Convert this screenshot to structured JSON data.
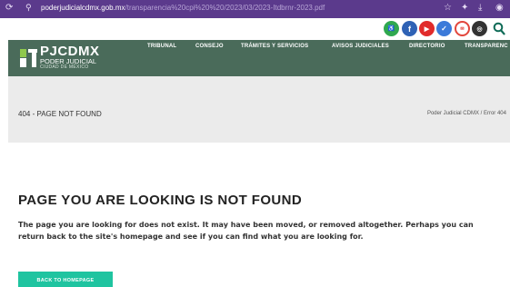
{
  "browser": {
    "url_host": "poderjudicialcdmx.gob.mx",
    "url_path": "/transparencia%20cpi%20%20/2023/03/2023-Itdbrnr-2023.pdf",
    "reload_icon": "reload-icon",
    "site_info_icon": "site-info-icon",
    "star_icon": "star-icon",
    "extensions_icon": "extensions-icon",
    "download_icon": "download-icon",
    "profile_icon": "profile-icon"
  },
  "social": {
    "icons": [
      "accessibility-icon",
      "facebook-icon",
      "youtube-icon",
      "twitter-icon",
      "vivo-icon",
      "instagram-icon"
    ],
    "search_icon": "search-icon"
  },
  "colors": {
    "browser_bar": "#5b3a8c",
    "header_green": "#4a6b5a",
    "band_gray": "#ebebeb",
    "button_teal": "#1fc4a0"
  },
  "header": {
    "logo_title": "PJCDMX",
    "logo_line1": "PODER JUDICIAL",
    "logo_line2": "CIUDAD DE MÉXICO",
    "nav": [
      "TRIBUNAL",
      "CONSEJO",
      "TRÁMITES Y SERVICIOS",
      "AVISOS JUDICIALES",
      "DIRECTORIO",
      "TRANSPARENC"
    ]
  },
  "crumb": {
    "heading": "404 - PAGE NOT FOUND",
    "path": "Poder Judicial CDMX / Error 404"
  },
  "main": {
    "title": "PAGE YOU ARE LOOKING IS NOT FOUND",
    "body": "The page you are looking for does not exist. It may have been moved, or removed altogether. Perhaps you can return back to the site's homepage and see if you can find what you are looking for.",
    "button": "BACK TO HOMEPAGE"
  }
}
